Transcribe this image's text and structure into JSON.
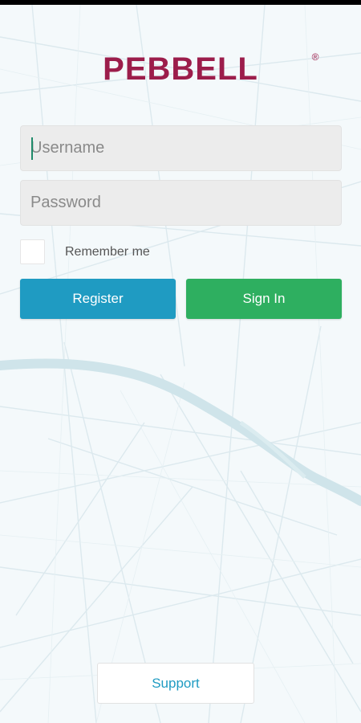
{
  "brand": {
    "name": "PEBBELL",
    "registered_mark": "®",
    "color": "#9c1d4b"
  },
  "login": {
    "username_placeholder": "Username",
    "password_placeholder": "Password",
    "remember_label": "Remember me",
    "remember_checked": false
  },
  "actions": {
    "register_label": "Register",
    "register_color": "#1f9bc2",
    "signin_label": "Sign In",
    "signin_color": "#2eaf60"
  },
  "footer": {
    "support_label": "Support"
  },
  "background": {
    "type": "map",
    "water_color": "#cfe4ea",
    "road_color": "#dde9ee"
  }
}
